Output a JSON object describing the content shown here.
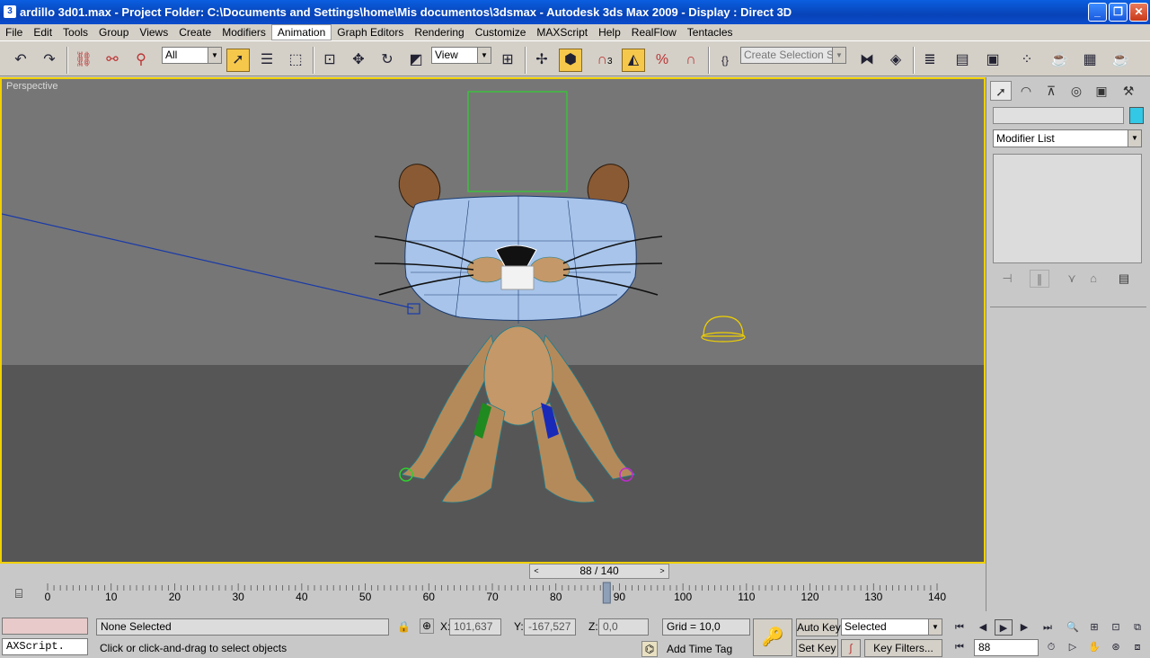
{
  "window": {
    "title": "ardillo 3d01.max      - Project Folder: C:\\Documents and Settings\\home\\Mis documentos\\3dsmax      - Autodesk 3ds Max  2009        - Display : Direct 3D",
    "minimize": "_",
    "maximize": "❐",
    "close": "✕"
  },
  "menubar": {
    "items": [
      "File",
      "Edit",
      "Tools",
      "Group",
      "Views",
      "Create",
      "Modifiers",
      "Animation",
      "Graph Editors",
      "Rendering",
      "Customize",
      "MAXScript",
      "Help",
      "RealFlow",
      "Tentacles"
    ],
    "active": "Animation"
  },
  "toolbar": {
    "selection_filter": "All",
    "reference_coord": "View",
    "named_selection_placeholder": "Create Selection Set",
    "snap_label": "3",
    "percent_snap_label": "%"
  },
  "viewport": {
    "label": "Perspective"
  },
  "command_panel": {
    "modifier_list": "Modifier List",
    "color": "#32c8e6"
  },
  "time_slider": {
    "value": "88 / 140",
    "prev": "<",
    "next": ">",
    "current_frame": 88,
    "total_frames": 140
  },
  "track_bar": {
    "ticks": [
      "0",
      "10",
      "20",
      "30",
      "40",
      "50",
      "60",
      "70",
      "80",
      "90",
      "100",
      "110",
      "120",
      "130",
      "140"
    ]
  },
  "status_bar": {
    "maxscript_listener": "AXScript.",
    "selection_status": "None Selected",
    "prompt": "Click or click-and-drag to select objects",
    "x_label": "X:",
    "x_value": "101,637",
    "y_label": "Y:",
    "y_value": "-167,527",
    "z_label": "Z:",
    "z_value": "0,0",
    "grid": "Grid = 10,0",
    "add_time_tag": "Add Time Tag",
    "auto_key": "Auto Key",
    "set_key": "Set Key",
    "key_mode": "Selected",
    "key_filters": "Key Filters...",
    "frame_field": "88"
  }
}
